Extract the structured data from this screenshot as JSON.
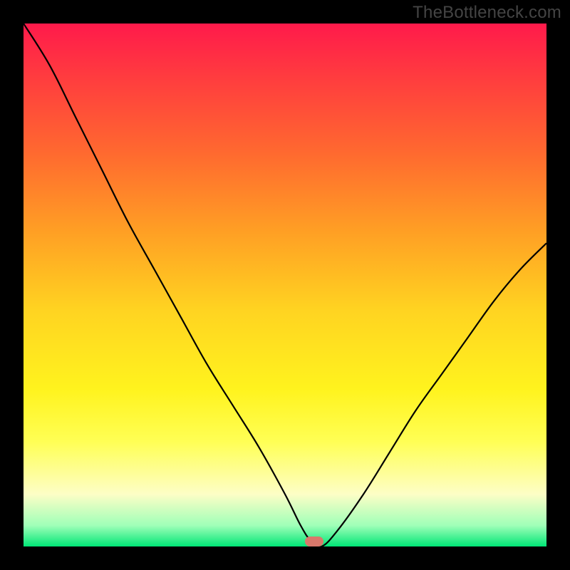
{
  "attribution": "TheBottleneck.com",
  "colors": {
    "frame_bg": "#000000",
    "attribution_text": "#444444",
    "curve_stroke": "#000000",
    "marker_fill": "#d9786b",
    "gradient_top": "#ff1a4b",
    "gradient_bottom": "#00e676"
  },
  "chart_data": {
    "type": "line",
    "title": "",
    "xlabel": "",
    "ylabel": "",
    "xlim": [
      0,
      100
    ],
    "ylim": [
      0,
      100
    ],
    "x": [
      0,
      5,
      10,
      15,
      20,
      25,
      30,
      35,
      40,
      45,
      50,
      53,
      55,
      57,
      60,
      65,
      70,
      75,
      80,
      85,
      90,
      95,
      100
    ],
    "y": [
      100,
      92,
      82,
      72,
      62,
      53,
      44,
      35,
      27,
      19,
      10,
      4,
      1,
      0,
      3,
      10,
      18,
      26,
      33,
      40,
      47,
      53,
      58
    ],
    "minimum": {
      "x": 57,
      "y": 0
    },
    "marker": {
      "x": 55.6,
      "y": 1.0,
      "width_pct": 3.5,
      "height_pct": 1.9
    }
  }
}
